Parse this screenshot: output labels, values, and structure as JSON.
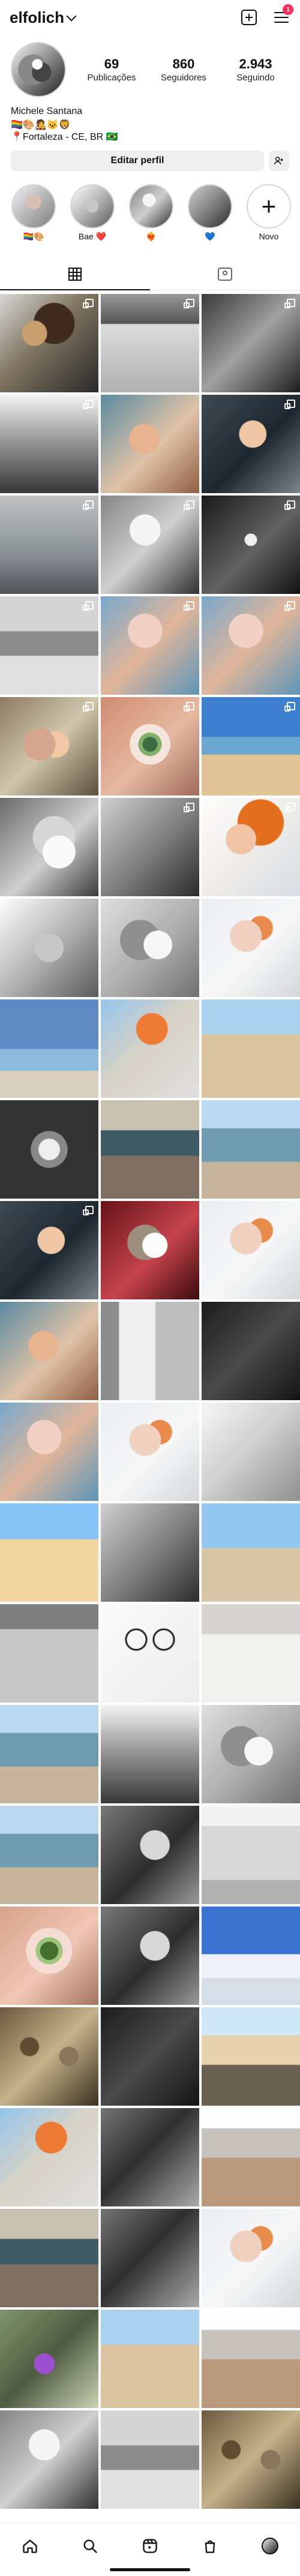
{
  "header": {
    "username": "elfolich",
    "notifications_badge": "1",
    "icons": {
      "account_switch": "chevron-down-icon",
      "create": "plus-square-icon",
      "menu": "menu-icon"
    }
  },
  "profile": {
    "stats": [
      {
        "value": "69",
        "label": "Publicações"
      },
      {
        "value": "860",
        "label": "Seguidores"
      },
      {
        "value": "2.943",
        "label": "Seguindo"
      }
    ],
    "name": "Michele Santana",
    "bio_line_1": "🏳️‍🌈🎨🧑‍🎤🐱🦁",
    "bio_line_2": "📍Fortaleza - CE, BR 🇧🇷",
    "edit_button": "Editar perfil"
  },
  "stories": [
    {
      "label": "🏳️‍🌈🎨",
      "image": "p-portrait3"
    },
    {
      "label": "Bae ❤️",
      "image": "p-cat4"
    },
    {
      "label": "❤️‍🔥",
      "image": "p-gray3"
    },
    {
      "label": "💙",
      "image": "p-gray2"
    },
    {
      "label": "Novo",
      "image": "new"
    }
  ],
  "tabs": [
    {
      "icon": "grid-icon",
      "active": true
    },
    {
      "icon": "tagged-posts-icon",
      "active": false
    }
  ],
  "grid": [
    {
      "image": "p-bw1",
      "carousel": true
    },
    {
      "image": "p-bw2",
      "carousel": true
    },
    {
      "image": "p-bw4",
      "carousel": true
    },
    {
      "image": "p-bw5",
      "carousel": true
    },
    {
      "image": "p-portrait4",
      "carousel": false
    },
    {
      "image": "p-portrait2",
      "carousel": true
    },
    {
      "image": "p-gray1",
      "carousel": true
    },
    {
      "image": "p-gray3",
      "carousel": true
    },
    {
      "image": "p-dark2",
      "carousel": true
    },
    {
      "image": "p-rocks3",
      "carousel": true
    },
    {
      "image": "p-portrait5",
      "carousel": true
    },
    {
      "image": "p-portrait5",
      "carousel": true
    },
    {
      "image": "p-portrait1",
      "carousel": true
    },
    {
      "image": "p-eye",
      "carousel": true
    },
    {
      "image": "p-beach3",
      "carousel": true
    },
    {
      "image": "p-cat",
      "carousel": false
    },
    {
      "image": "p-gray2",
      "carousel": true
    },
    {
      "image": "p-orange1",
      "carousel": true
    },
    {
      "image": "p-cat4",
      "carousel": false
    },
    {
      "image": "p-cat2",
      "carousel": false
    },
    {
      "image": "p-portrait6",
      "carousel": false
    },
    {
      "image": "p-blueocean",
      "carousel": false
    },
    {
      "image": "p-orange2",
      "carousel": false
    },
    {
      "image": "p-sand2",
      "carousel": false
    },
    {
      "image": "p-bw3",
      "carousel": false
    },
    {
      "image": "p-sea2",
      "carousel": false
    },
    {
      "image": "p-sea1",
      "carousel": false
    },
    {
      "image": "p-portrait2",
      "carousel": true
    },
    {
      "image": "p-redcat",
      "carousel": false
    },
    {
      "image": "p-portrait6",
      "carousel": false
    },
    {
      "image": "p-portrait4",
      "carousel": false
    },
    {
      "image": "p-window2",
      "carousel": false
    },
    {
      "image": "p-dark1",
      "carousel": false
    },
    {
      "image": "p-portrait5",
      "carousel": false
    },
    {
      "image": "p-portrait6",
      "carousel": false
    },
    {
      "image": "p-ice",
      "carousel": false
    },
    {
      "image": "p-sand",
      "carousel": false
    },
    {
      "image": "p-gray2",
      "carousel": false
    },
    {
      "image": "p-beach1",
      "carousel": false
    },
    {
      "image": "p-concrete",
      "carousel": false
    },
    {
      "image": "p-drawing",
      "carousel": false
    },
    {
      "image": "p-sign",
      "carousel": false
    },
    {
      "image": "p-sea1",
      "carousel": false
    },
    {
      "image": "p-bw5",
      "carousel": false
    },
    {
      "image": "p-cat2",
      "carousel": false
    },
    {
      "image": "p-sea1",
      "carousel": false
    },
    {
      "image": "p-cat3",
      "carousel": false
    },
    {
      "image": "p-window",
      "carousel": false
    },
    {
      "image": "p-eye2",
      "carousel": false
    },
    {
      "image": "p-cat3",
      "carousel": false
    },
    {
      "image": "p-blue-sky",
      "carousel": false
    },
    {
      "image": "p-plants",
      "carousel": false
    },
    {
      "image": "p-dark1",
      "carousel": false
    },
    {
      "image": "p-rock-beach",
      "carousel": false
    },
    {
      "image": "p-orange2",
      "carousel": false
    },
    {
      "image": "p-rocks2",
      "carousel": false
    },
    {
      "image": "p-sunset",
      "carousel": false
    },
    {
      "image": "p-sea2",
      "carousel": false
    },
    {
      "image": "p-rocks2",
      "carousel": false
    },
    {
      "image": "p-portrait6",
      "carousel": false
    },
    {
      "image": "p-purple",
      "carousel": false
    },
    {
      "image": "p-sand2",
      "carousel": false
    },
    {
      "image": "p-sunset",
      "carousel": false
    },
    {
      "image": "p-gray3",
      "carousel": false
    },
    {
      "image": "p-rocks3",
      "carousel": false
    },
    {
      "image": "p-plants",
      "carousel": false
    }
  ],
  "bottom_nav": [
    {
      "icon": "home-icon"
    },
    {
      "icon": "search-icon"
    },
    {
      "icon": "reels-icon"
    },
    {
      "icon": "shop-icon"
    },
    {
      "icon": "profile-avatar-icon"
    }
  ]
}
